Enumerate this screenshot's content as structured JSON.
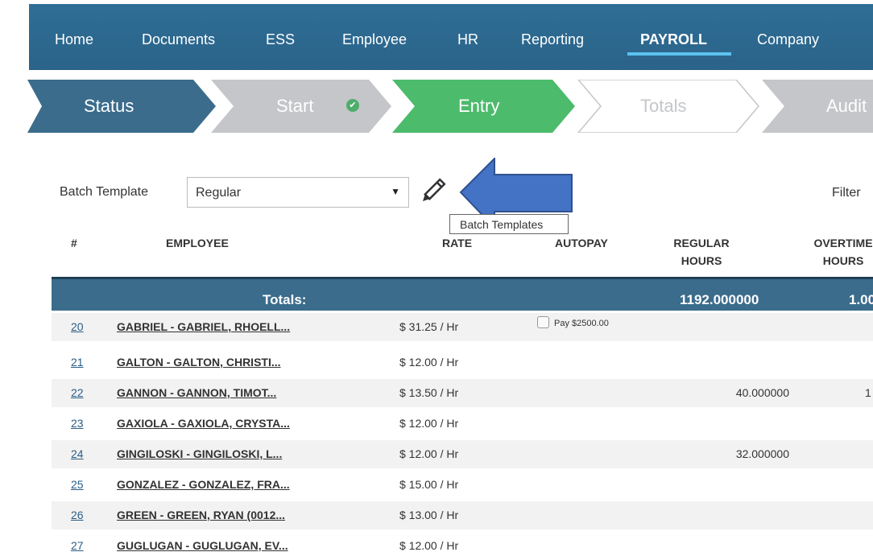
{
  "nav": {
    "items": [
      "Home",
      "Documents",
      "ESS",
      "Employee",
      "HR",
      "Reporting",
      "PAYROLL",
      "Company"
    ],
    "active": "PAYROLL"
  },
  "steps": [
    {
      "label": "Status",
      "state": "current",
      "color": "#3b6c8c"
    },
    {
      "label": "Start",
      "state": "completed",
      "color": "#c4c6c9"
    },
    {
      "label": "Entry",
      "state": "active",
      "color": "#4cbb6c"
    },
    {
      "label": "Totals",
      "state": "pending",
      "color": "#ffffff"
    },
    {
      "label": "Audit",
      "state": "pending",
      "color": "#c4c6c9"
    }
  ],
  "batch": {
    "label": "Batch Template",
    "selected": "Regular",
    "tooltip": "Batch Templates",
    "edit_icon": "pencil-icon",
    "filter_label": "Filter"
  },
  "table": {
    "headers": {
      "num": "#",
      "employee": "EMPLOYEE",
      "rate": "RATE",
      "autopay": "AUTOPAY",
      "regular_1": "REGULAR",
      "regular_2": "HOURS",
      "overtime_1": "OVERTIME",
      "overtime_2": "HOURS"
    },
    "totals": {
      "label": "Totals:",
      "regular": "1192.000000",
      "overtime": "1.00"
    },
    "rows": [
      {
        "num": "20",
        "employee": "GABRIEL - GABRIEL, RHOELL...",
        "rate": "$ 31.25 / Hr",
        "autopay": "Pay $2500.00",
        "regular": "",
        "overtime": ""
      },
      {
        "num": "21",
        "employee": "GALTON - GALTON, CHRISTI...",
        "rate": "$ 12.00 / Hr",
        "autopay": "",
        "regular": "",
        "overtime": ""
      },
      {
        "num": "22",
        "employee": "GANNON - GANNON, TIMOT...",
        "rate": "$ 13.50 / Hr",
        "autopay": "",
        "regular": "40.000000",
        "overtime": "1"
      },
      {
        "num": "23",
        "employee": "GAXIOLA - GAXIOLA, CRYSTA...",
        "rate": "$ 12.00 / Hr",
        "autopay": "",
        "regular": "",
        "overtime": ""
      },
      {
        "num": "24",
        "employee": "GINGILOSKI - GINGILOSKI, L...",
        "rate": "$ 12.00 / Hr",
        "autopay": "",
        "regular": "32.000000",
        "overtime": ""
      },
      {
        "num": "25",
        "employee": "GONZALEZ - GONZALEZ, FRA...",
        "rate": "$ 15.00 / Hr",
        "autopay": "",
        "regular": "",
        "overtime": ""
      },
      {
        "num": "26",
        "employee": "GREEN - GREEN, RYAN (0012...",
        "rate": "$ 13.00 / Hr",
        "autopay": "",
        "regular": "",
        "overtime": ""
      },
      {
        "num": "27",
        "employee": "GUGLUGAN - GUGLUGAN, EV...",
        "rate": "$ 12.00 / Hr",
        "autopay": "",
        "regular": "",
        "overtime": ""
      }
    ]
  },
  "colors": {
    "nav_bg": "#2f6e95",
    "accent_underline": "#5bc2ef",
    "arrow": "#4472c4",
    "totals_bg": "#3b6c8c"
  }
}
